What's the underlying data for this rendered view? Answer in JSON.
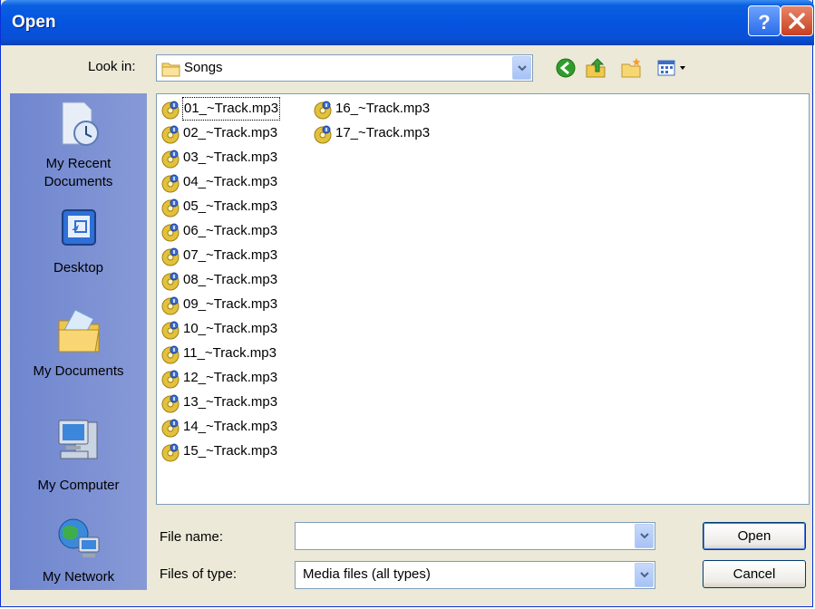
{
  "window": {
    "title": "Open"
  },
  "titlebar": {
    "help_icon": "help-icon",
    "close_icon": "close-icon"
  },
  "lookin": {
    "label": "Look in:",
    "value": "Songs"
  },
  "toolbar": {
    "icons": [
      "back-icon",
      "up-folder-icon",
      "new-folder-icon",
      "views-menu-icon"
    ]
  },
  "places": [
    {
      "label": "My Recent Documents",
      "line1": "My Recent",
      "line2": "Documents",
      "icon": "recent-documents-icon"
    },
    {
      "label": "Desktop",
      "line1": "Desktop",
      "icon": "desktop-icon"
    },
    {
      "label": "My Documents",
      "line1": "My Documents",
      "icon": "my-documents-icon"
    },
    {
      "label": "My Computer",
      "line1": "My Computer",
      "icon": "my-computer-icon"
    },
    {
      "label": "My Network",
      "line1": "My Network",
      "icon": "my-network-icon"
    }
  ],
  "files": [
    "01_~Track.mp3",
    "02_~Track.mp3",
    "03_~Track.mp3",
    "04_~Track.mp3",
    "05_~Track.mp3",
    "06_~Track.mp3",
    "07_~Track.mp3",
    "08_~Track.mp3",
    "09_~Track.mp3",
    "10_~Track.mp3",
    "11_~Track.mp3",
    "12_~Track.mp3",
    "13_~Track.mp3",
    "14_~Track.mp3",
    "15_~Track.mp3",
    "16_~Track.mp3",
    "17_~Track.mp3"
  ],
  "filename": {
    "label": "File name:",
    "value": ""
  },
  "filetype": {
    "label": "Files of type:",
    "value": "Media files (all types)"
  },
  "buttons": {
    "open": "Open",
    "cancel": "Cancel"
  },
  "colors": {
    "titlebar": "#0554E0",
    "dialog_bg": "#ECE9D8",
    "places_bar": "#7B8FCE"
  }
}
